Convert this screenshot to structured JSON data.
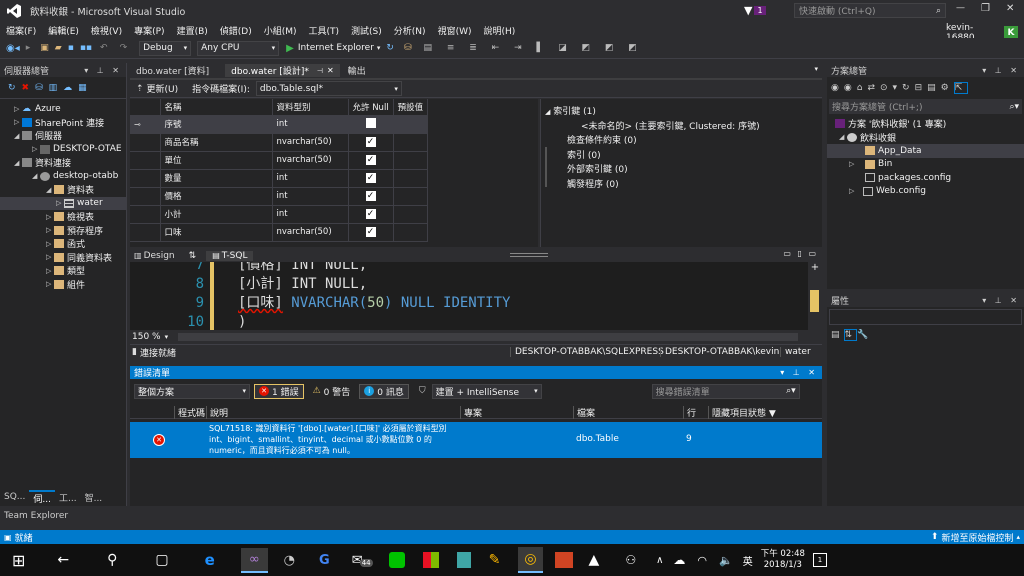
{
  "window": {
    "title": "飲料收銀 - Microsoft Visual Studio",
    "notif_count": "1",
    "quick_launch_placeholder": "快速啟動 (Ctrl+Q)",
    "user": "kevin-16880",
    "user_initial": "K"
  },
  "menu": [
    "檔案(F)",
    "編輯(E)",
    "檢視(V)",
    "專案(P)",
    "建置(B)",
    "偵錯(D)",
    "小組(M)",
    "工具(T)",
    "測試(S)",
    "分析(N)",
    "視窗(W)",
    "說明(H)"
  ],
  "toolbar": {
    "config": "Debug",
    "platform": "Any CPU",
    "run_label": "Internet Explorer"
  },
  "server_explorer": {
    "title": "伺服器總管",
    "items": [
      {
        "label": "Azure",
        "indent": 0,
        "expand": "▷"
      },
      {
        "label": "SharePoint 連接",
        "indent": 0,
        "expand": "▷"
      },
      {
        "label": "伺服器",
        "indent": 0,
        "expand": "◢"
      },
      {
        "label": "DESKTOP-OTAE",
        "indent": 1,
        "expand": "▷"
      },
      {
        "label": "資料連接",
        "indent": 0,
        "expand": "◢"
      },
      {
        "label": "desktop-otabb",
        "indent": 1,
        "expand": "◢"
      },
      {
        "label": "資料表",
        "indent": 2,
        "expand": "◢"
      },
      {
        "label": "water",
        "indent": 3,
        "expand": "▷",
        "selected": true
      },
      {
        "label": "檢視表",
        "indent": 2,
        "expand": "▷"
      },
      {
        "label": "預存程序",
        "indent": 2,
        "expand": "▷"
      },
      {
        "label": "函式",
        "indent": 2,
        "expand": "▷"
      },
      {
        "label": "同義資料表",
        "indent": 2,
        "expand": "▷"
      },
      {
        "label": "類型",
        "indent": 2,
        "expand": "▷"
      },
      {
        "label": "組件",
        "indent": 2,
        "expand": "▷"
      }
    ],
    "bottom_tabs": [
      "SQ...",
      "伺...",
      "工...",
      "智..."
    ]
  },
  "team_explorer": "Team Explorer",
  "doc_tabs": [
    "dbo.water [資料]",
    "dbo.water [設計]*",
    "輸出"
  ],
  "designer": {
    "update_label": "更新(U)",
    "script_label": "指令碼檔案(I):",
    "script_file": "dbo.Table.sql*",
    "columns": [
      "名稱",
      "資料型別",
      "允許 Null",
      "預設值"
    ],
    "rows": [
      {
        "name": "序號",
        "type": "int",
        "null": false,
        "key": true
      },
      {
        "name": "商品名稱",
        "type": "nvarchar(50)",
        "null": true
      },
      {
        "name": "單位",
        "type": "nvarchar(50)",
        "null": true
      },
      {
        "name": "數量",
        "type": "int",
        "null": true
      },
      {
        "name": "價格",
        "type": "int",
        "null": true
      },
      {
        "name": "小計",
        "type": "int",
        "null": true
      },
      {
        "name": "口味",
        "type": "nvarchar(50)",
        "null": true
      }
    ],
    "props": [
      "索引鍵 (1)",
      "<未命名的>   (主要索引鍵, Clustered: 序號)",
      "檢查條件約束 (0)",
      "索引 (0)",
      "外部索引鍵 (0)",
      "觸發程序 (0)"
    ],
    "pane_tabs": [
      "Design",
      "⇅",
      "T-SQL"
    ]
  },
  "code": {
    "lines": [
      {
        "num": "7",
        "text": "[價格] INT NULL,"
      },
      {
        "num": "8",
        "text": "[小計] INT NULL,"
      },
      {
        "num": "9",
        "ident": "[口味]",
        "type": "NVARCHAR(",
        "size": "50",
        "rest": ") NULL IDENTITY"
      },
      {
        "num": "10",
        "text": ")"
      }
    ],
    "zoom": "150 %"
  },
  "status_conn": {
    "label": "連接就緒",
    "server": "DESKTOP-OTABBAK\\SQLEXPRESS",
    "user": "DESKTOP-OTABBAK\\kevin",
    "db": "water"
  },
  "error_list": {
    "title": "錯誤清單",
    "scope": "整個方案",
    "errors": "1 錯誤",
    "warnings": "0 警告",
    "messages": "0 訊息",
    "build": "建置 + IntelliSense",
    "search_placeholder": "搜尋錯誤清單",
    "headers": [
      "程式碼",
      "說明",
      "專案",
      "檔案",
      "行",
      "隱藏項目狀態"
    ],
    "row": {
      "desc": "SQL71518: 識別資料行 '[dbo].[water].[口味]' 必須屬於資料型別 int、bigint、smallint、tinyint、decimal 或小數點位數 0 的 numeric，而且資料行必須不可為 null。",
      "file": "dbo.Table",
      "line": "9"
    }
  },
  "solution_explorer": {
    "title": "方案總管",
    "search_placeholder": "搜尋方案總管 (Ctrl+;)",
    "items": [
      {
        "label": "方案 '飲料收銀' (1 專案)",
        "indent": 0
      },
      {
        "label": "飲料收銀",
        "indent": 1,
        "expand": "◢"
      },
      {
        "label": "App_Data",
        "indent": 2,
        "selected": true
      },
      {
        "label": "Bin",
        "indent": 2,
        "expand": "▷"
      },
      {
        "label": "packages.config",
        "indent": 2
      },
      {
        "label": "Web.config",
        "indent": 2,
        "expand": "▷"
      }
    ]
  },
  "properties": {
    "title": "屬性"
  },
  "statusbar": {
    "left": "就緒",
    "right": "新增至原始檔控制"
  },
  "taskbar": {
    "mail_badge": "44",
    "ime": "英",
    "time": "下午 02:48",
    "date": "2018/1/3",
    "notif": "1"
  },
  "colors": {
    "accent": "#007acc",
    "error": "#e51400",
    "vs_purple": "#68217a"
  }
}
